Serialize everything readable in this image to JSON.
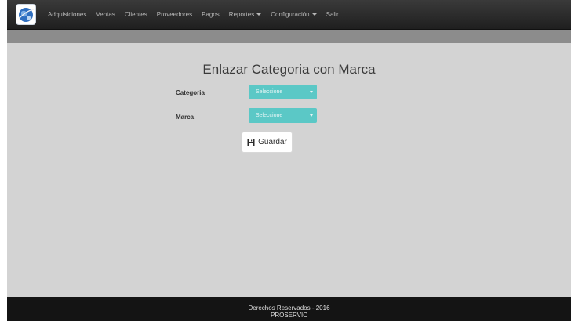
{
  "nav": {
    "items": [
      "Adquisiciones",
      "Ventas",
      "Clientes",
      "Proveedores",
      "Pagos"
    ],
    "reportes": "Reportes",
    "configuracion": "Configuración",
    "salir": "Salir"
  },
  "main": {
    "title": "Enlazar Categoria con Marca",
    "categoria_label": "Categoria",
    "categoria_value": "Seleccione",
    "marca_label": "Marca",
    "marca_value": "Seleccione",
    "save_label": "Guardar"
  },
  "footer": {
    "line1": "Derechos Reservados - 2016",
    "line2": "PROSERVIC"
  },
  "colors": {
    "navbar": "#262626",
    "background": "#d3d3d3",
    "select": "#5bc8c6",
    "footer": "#141414"
  },
  "icons": {
    "logo": "globe-logo",
    "save": "floppy-disk-icon"
  }
}
